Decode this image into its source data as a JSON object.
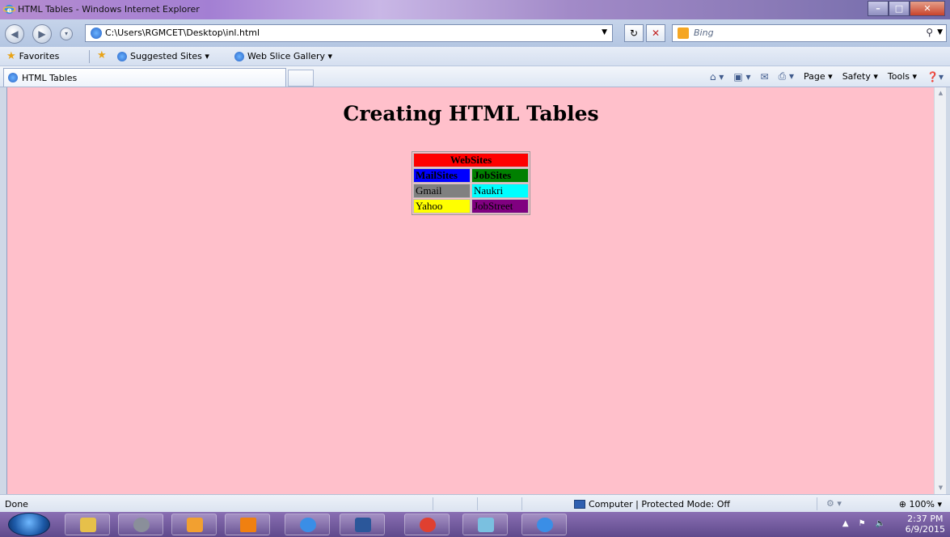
{
  "window": {
    "title": "HTML Tables - Windows Internet Explorer"
  },
  "address_bar": {
    "url": "C:\\Users\\RGMCET\\Desktop\\inl.html",
    "search_placeholder": "Bing"
  },
  "favorites_bar": {
    "favorites_label": "Favorites",
    "suggested_sites": "Suggested Sites ▾",
    "web_slice_gallery": "Web Slice Gallery ▾"
  },
  "tab": {
    "title": "HTML Tables"
  },
  "command_bar": {
    "page": "Page ▾",
    "safety": "Safety ▾",
    "tools": "Tools ▾"
  },
  "page": {
    "heading": "Creating HTML Tables",
    "table": {
      "header": "WebSites",
      "rows": [
        {
          "cells": [
            {
              "text": "MailSites",
              "bg": "#0000ff"
            },
            {
              "text": "JobSites",
              "bg": "#008000"
            }
          ]
        },
        {
          "cells": [
            {
              "text": "Gmail",
              "bg": "#808080"
            },
            {
              "text": "Naukri",
              "bg": "#00ffff"
            }
          ]
        },
        {
          "cells": [
            {
              "text": "Yahoo",
              "bg": "#ffff00"
            },
            {
              "text": "JobStreet",
              "bg": "#800080"
            }
          ]
        }
      ],
      "header_bg": "#ff0000",
      "page_bg": "#ffc0cb"
    }
  },
  "status_bar": {
    "status": "Done",
    "zone": "Computer | Protected Mode: Off",
    "zoom": "100%"
  },
  "taskbar": {
    "time": "2:37 PM",
    "date": "6/9/2015"
  }
}
